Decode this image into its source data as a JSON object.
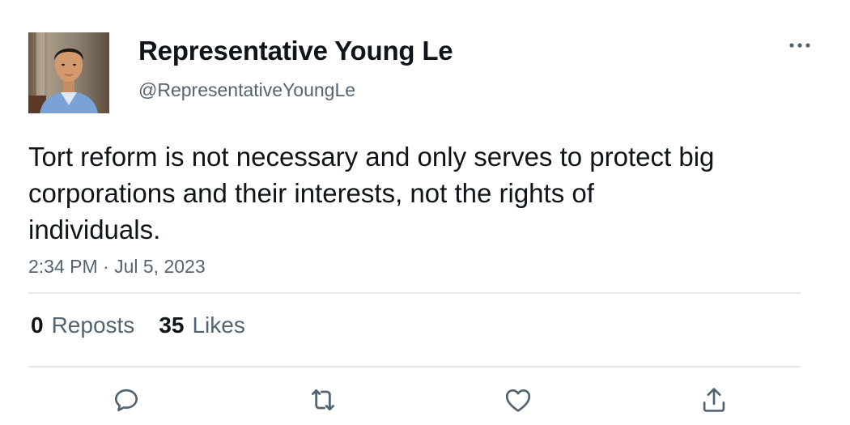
{
  "user": {
    "display_name": "Representative Young Le",
    "handle": "@RepresentativeYoungLe",
    "avatar_icon": "profile-photo"
  },
  "tweet": {
    "text": "Tort reform is not necessary and only serves to protect big corporations and their interests, not the rights of individuals.",
    "timestamp": "2:34 PM · Jul 5, 2023"
  },
  "stats": {
    "reposts_count": "0",
    "reposts_label": "Reposts",
    "likes_count": "35",
    "likes_label": "Likes"
  },
  "actions": [
    {
      "icon": "reply-icon"
    },
    {
      "icon": "repost-icon"
    },
    {
      "icon": "like-icon"
    },
    {
      "icon": "share-icon"
    }
  ],
  "colors": {
    "text_primary": "#0f1419",
    "text_secondary": "#536471",
    "divider": "#e3e7ea"
  }
}
